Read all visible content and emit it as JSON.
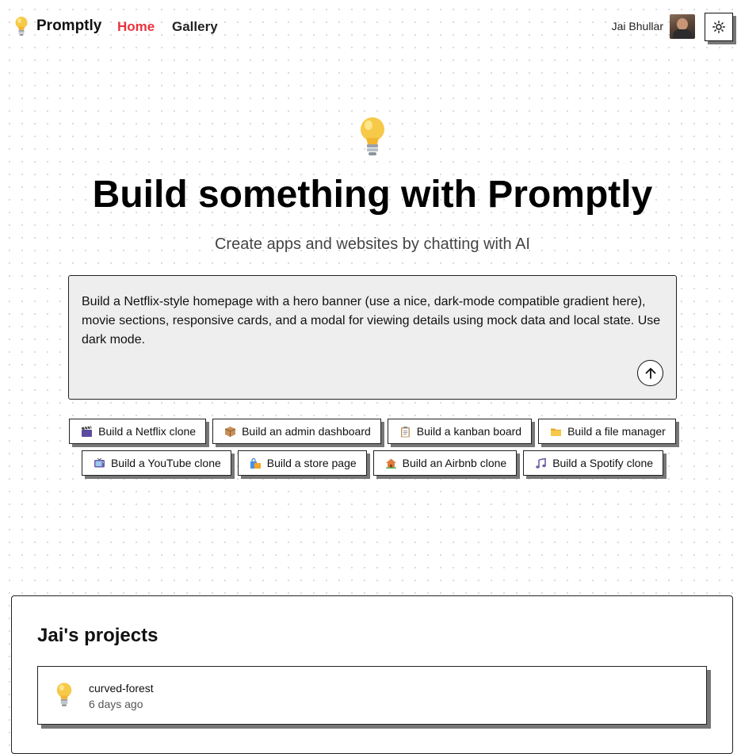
{
  "nav": {
    "brand": "Promptly",
    "links": [
      {
        "label": "Home",
        "active": true
      },
      {
        "label": "Gallery",
        "active": false
      }
    ],
    "user_name": "Jai Bhullar",
    "theme_icon": "sun-icon"
  },
  "colors": {
    "accent": "#e8333d",
    "prompt_bg": "#eeeeee",
    "shadow": "#777777"
  },
  "hero": {
    "icon": "lightbulb-icon",
    "title": "Build something with Promptly",
    "subtitle": "Create apps and websites by chatting with AI"
  },
  "prompt": {
    "value": "Build a Netflix-style homepage with a hero banner (use a nice, dark-mode compatible gradient here), movie sections, responsive cards, and a modal for viewing details using mock data and local state. Use dark mode.",
    "send_icon": "arrow-up-icon"
  },
  "suggestions": [
    {
      "label": "Build a Netflix clone",
      "icon": "clapper-icon"
    },
    {
      "label": "Build an admin dashboard",
      "icon": "package-icon"
    },
    {
      "label": "Build a kanban board",
      "icon": "clipboard-icon"
    },
    {
      "label": "Build a file manager",
      "icon": "folder-icon"
    },
    {
      "label": "Build a YouTube clone",
      "icon": "tv-icon"
    },
    {
      "label": "Build a store page",
      "icon": "shopping-bags-icon"
    },
    {
      "label": "Build an Airbnb clone",
      "icon": "house-icon"
    },
    {
      "label": "Build a Spotify clone",
      "icon": "music-note-icon"
    }
  ],
  "projects": {
    "title": "Jai's projects",
    "items": [
      {
        "name": "curved-forest",
        "time": "6 days ago",
        "icon": "lightbulb-icon"
      }
    ]
  }
}
